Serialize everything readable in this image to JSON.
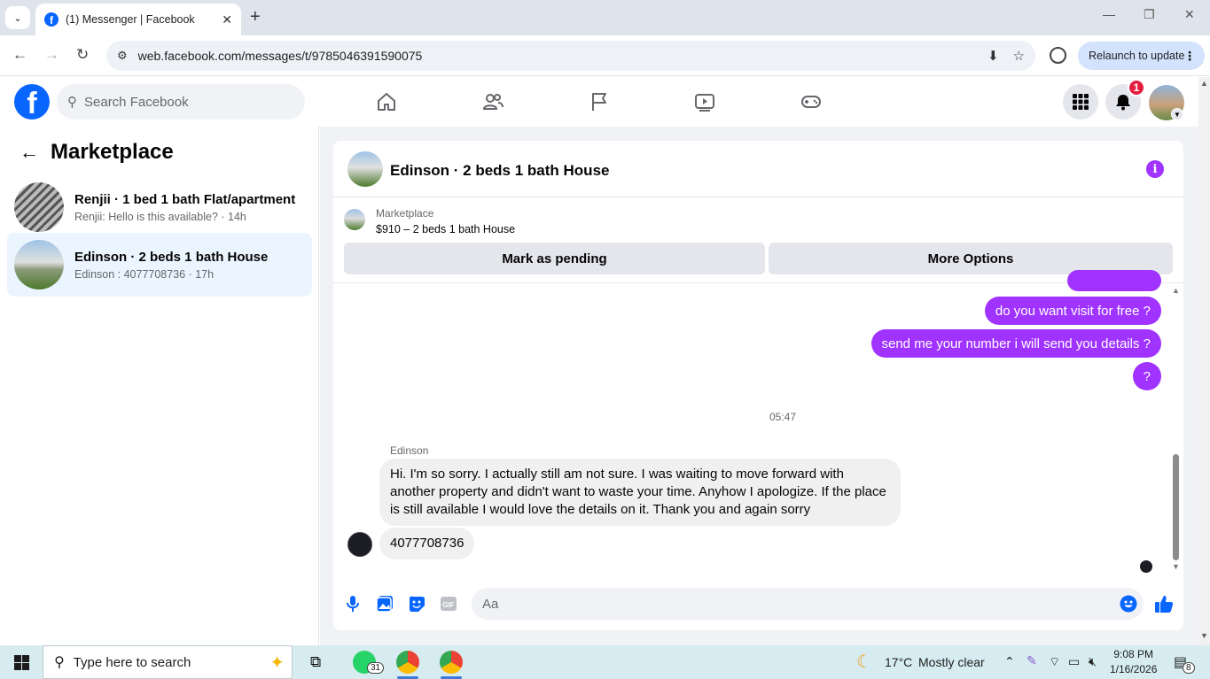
{
  "browser": {
    "tab_title": "(1) Messenger | Facebook",
    "url": "web.facebook.com/messages/t/9785046391590075",
    "relaunch_label": "Relaunch to update"
  },
  "fb": {
    "search_placeholder": "Search Facebook",
    "notification_count": "1"
  },
  "sidebar": {
    "title": "Marketplace",
    "conversations": [
      {
        "name": "Renjii · 1 bed 1 bath Flat/apartment",
        "preview": "Renjii: Hello is this available? · 14h",
        "active": false
      },
      {
        "name": "Edinson · 2 beds 1 bath House",
        "preview": "Edinson : 4077708736 · 17h",
        "active": true
      }
    ]
  },
  "chat": {
    "title": "Edinson · 2 beds 1 bath House",
    "listing_source": "Marketplace",
    "listing_price": "$910 – 2 beds 1 bath House",
    "mark_pending_label": "Mark as pending",
    "more_options_label": "More Options",
    "outgoing": [
      "do you want visit for free ?",
      "send me your number i will send you details ?",
      "?"
    ],
    "timestamp": "05:47",
    "sender_name": "Edinson",
    "incoming": [
      "Hi.  I'm so sorry.  I actually still am not sure.  I was waiting to move forward with another property and didn't want to waste your time.  Anyhow I apologize.  If the place is still available I would love the details on it.  Thank you and again sorry",
      "4077708736"
    ],
    "composer_placeholder": "Aa"
  },
  "taskbar": {
    "search_placeholder": "Type here to search",
    "whatsapp_badge": "31",
    "weather_temp": "17°C",
    "weather_desc": "Mostly clear",
    "time": "9:08 PM",
    "date": "1/16/2026",
    "notif_count": "8"
  },
  "colors": {
    "fb_blue": "#0866ff",
    "messenger_purple": "#a033ff",
    "active_conv_bg": "#ebf5ff"
  }
}
